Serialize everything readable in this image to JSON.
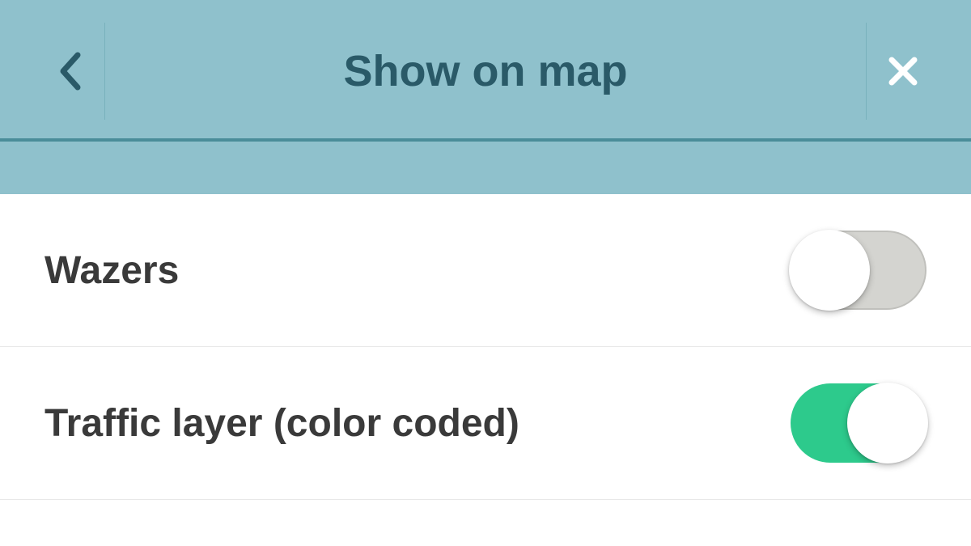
{
  "header": {
    "title": "Show on map"
  },
  "settings": {
    "wazers": {
      "label": "Wazers",
      "enabled": false
    },
    "traffic_layer": {
      "label": "Traffic layer (color coded)",
      "enabled": true
    }
  },
  "colors": {
    "header_bg": "#8fc1cc",
    "header_text": "#2a5a68",
    "toggle_on": "#2dca8c",
    "toggle_off": "#d4d4d0"
  }
}
